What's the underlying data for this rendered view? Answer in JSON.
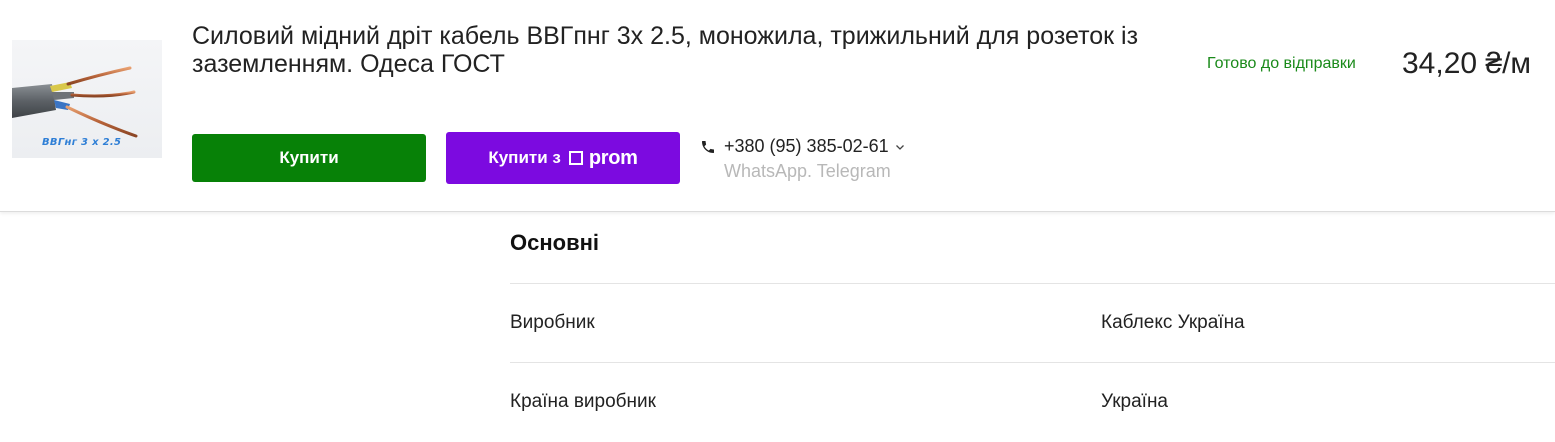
{
  "product": {
    "image_caption": "ВВГнг  3 х 2.5",
    "title": "Силовий мідний дріт кабель ВВГпнг 3х 2.5, моножила, трижильний для розеток із заземленням. Одеса ГОСТ",
    "stock_status": "Готово до відправки",
    "price": "34,20 ₴/м"
  },
  "actions": {
    "buy_label": "Купити",
    "buy_prom_label": "Купити з",
    "prom_brand": "prom",
    "phone_icon": "phone-icon",
    "phone": "+380 (95) 385-02-61",
    "messengers": "WhatsApp. Telegram"
  },
  "specs": {
    "heading": "Основні",
    "rows": [
      {
        "label": "Виробник",
        "value": "Каблекс Україна"
      },
      {
        "label": "Країна виробник",
        "value": "Україна"
      }
    ]
  },
  "colors": {
    "buy_button": "#078107",
    "prom_button": "#7c0ae0",
    "stock_green": "#1a8a1a"
  }
}
